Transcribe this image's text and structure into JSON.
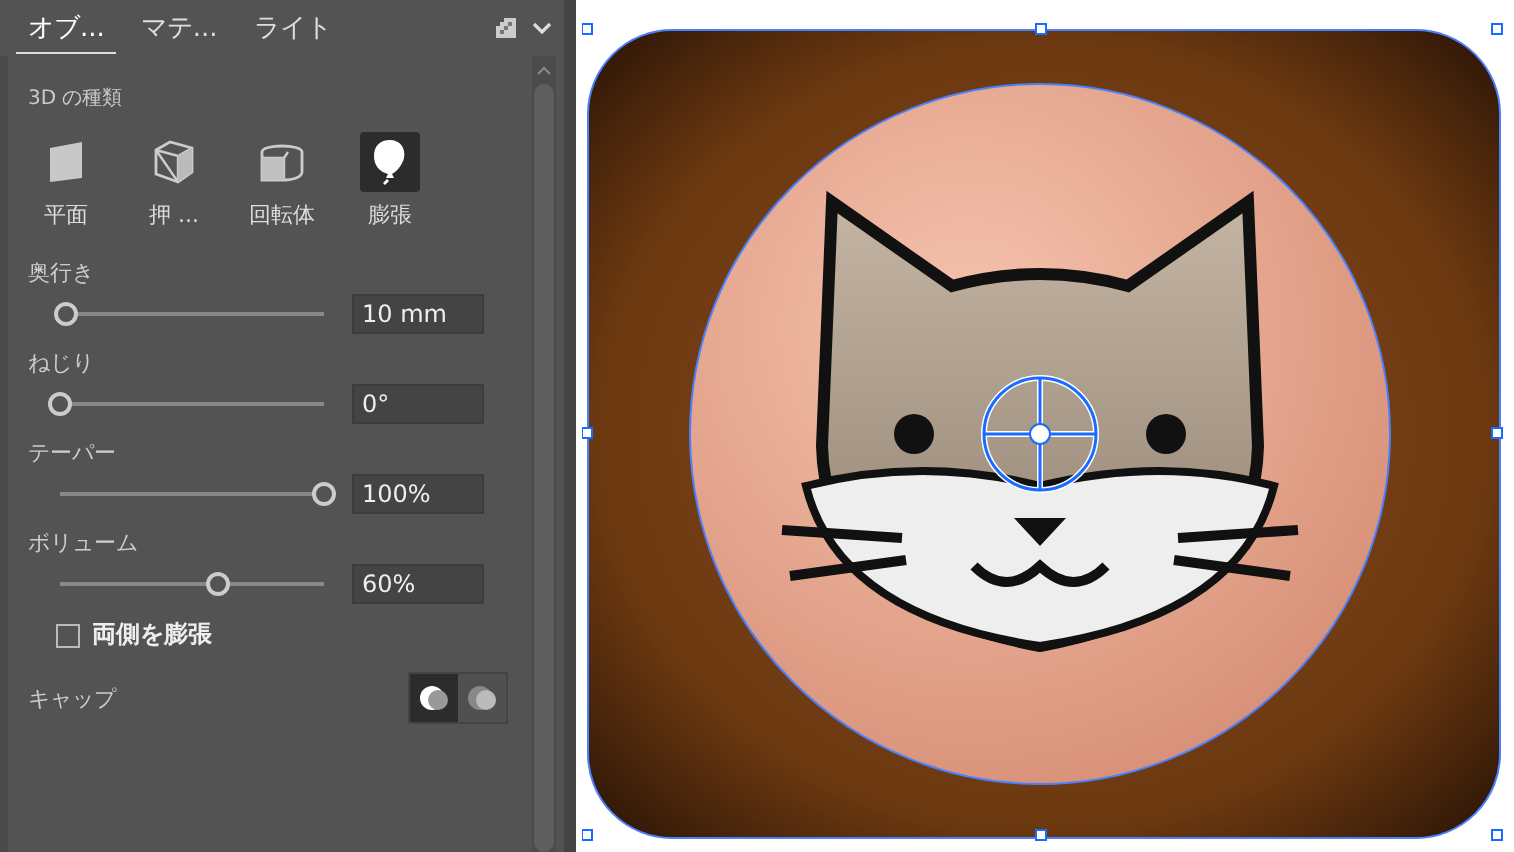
{
  "tabs": [
    {
      "label": "オブ...",
      "selected": true
    },
    {
      "label": "マテ...",
      "selected": false
    },
    {
      "label": "ライト",
      "selected": false
    }
  ],
  "section_title": "3D の種類",
  "types": [
    {
      "label": "平面",
      "kind": "plane",
      "selected": false
    },
    {
      "label": "押 ...",
      "kind": "extrude",
      "selected": false
    },
    {
      "label": "回転体",
      "kind": "revolve",
      "selected": false
    },
    {
      "label": "膨張",
      "kind": "inflate",
      "selected": true
    }
  ],
  "sliders": [
    {
      "label": "奥行き",
      "level": 0.02,
      "value": "10 mm"
    },
    {
      "label": "ねじり",
      "level": 0.0,
      "value": "0°"
    },
    {
      "label": "テーパー",
      "level": 1.0,
      "value": "100%"
    },
    {
      "label": "ボリューム",
      "level": 0.6,
      "value": "60%"
    }
  ],
  "both_sides": {
    "label": "両側を膨張",
    "checked": false
  },
  "cap": {
    "label": "キャップ",
    "options": [
      {
        "kind": "on",
        "selected": true
      },
      {
        "kind": "off",
        "selected": false
      }
    ]
  }
}
